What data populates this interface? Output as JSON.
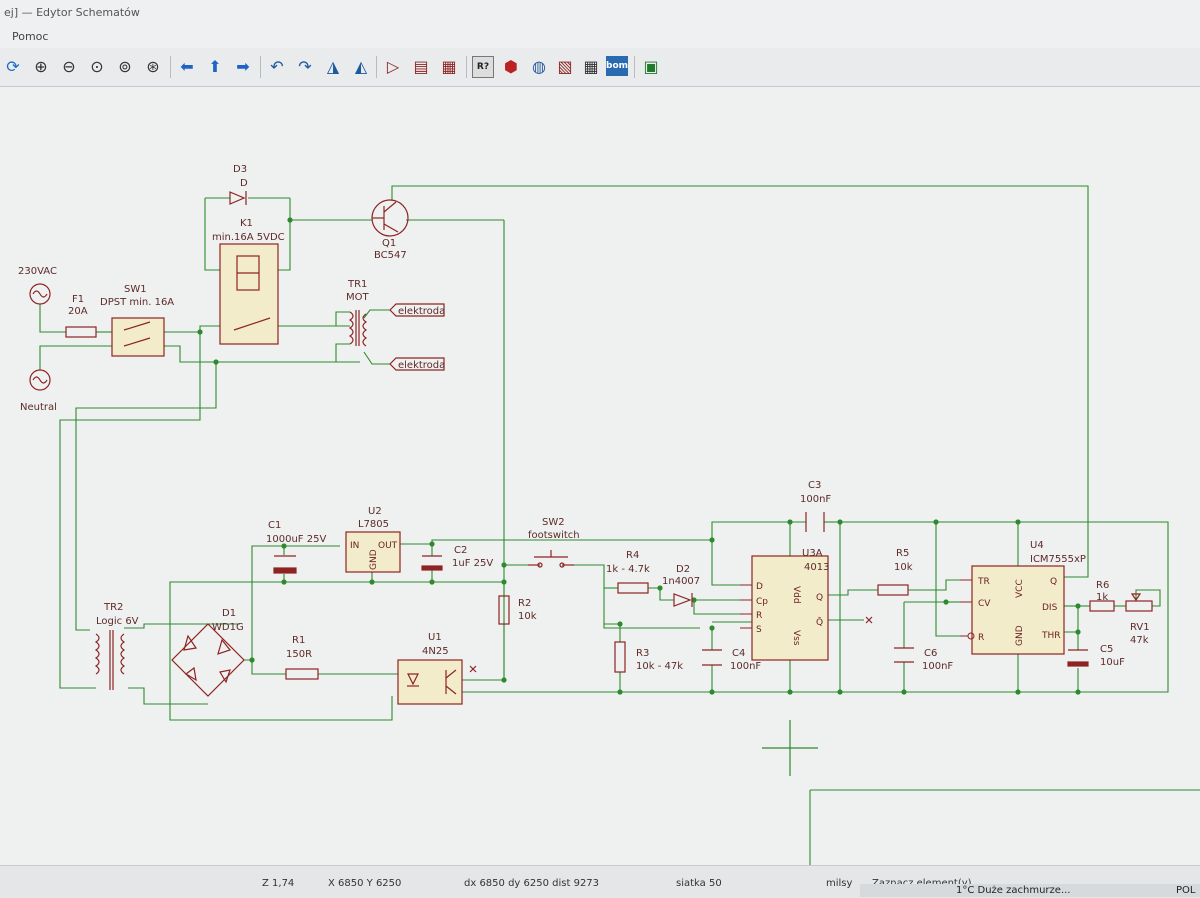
{
  "window": {
    "title": "ej] — Edytor Schematów"
  },
  "menu": {
    "help": "Pomoc"
  },
  "toolbar": {
    "icons": [
      "refresh-icon",
      "zoom-in-icon",
      "zoom-out-icon",
      "zoom-fit-icon",
      "zoom-redraw-icon",
      "zoom-selection-icon",
      "arrow-left-icon",
      "arrow-up-icon",
      "arrow-right-icon",
      "undo-icon",
      "redo-icon",
      "mirror-horizontal-icon",
      "mirror-vertical-icon",
      "erc-icon",
      "library-icon",
      "annotate-icon",
      "netlist-icon",
      "simulate-icon",
      "footprint-icon",
      "table-icon",
      "bom-icon",
      "pcb-icon"
    ]
  },
  "schematic": {
    "labels": {
      "d3_ref": "D3",
      "d3_val": "D",
      "k1_ref": "K1",
      "k1_val": "min.16A 5VDC",
      "q1_ref": "Q1",
      "q1_val": "BC547",
      "ac1": "230VAC",
      "neutral": "Neutral",
      "f1_ref": "F1",
      "f1_val": "20A",
      "sw1_ref": "SW1",
      "sw1_val": "DPST min. 16A",
      "tr1_ref": "TR1",
      "tr1_val": "MOT",
      "elektroda_1": "elektroda",
      "elektroda_2": "elektroda",
      "tr2_ref": "TR2",
      "tr2_val": "Logic 6V",
      "d1_ref": "D1",
      "d1_val": "WD1G",
      "c1_ref": "C1",
      "c1_val": "1000uF 25V",
      "u2_ref": "U2",
      "u2_val": "L7805",
      "u2_in": "IN",
      "u2_out": "OUT",
      "u2_gnd": "GND",
      "c2_ref": "C2",
      "c2_val": "1uF 25V",
      "sw2_ref": "SW2",
      "sw2_val": "footswitch",
      "r1_ref": "R1",
      "r1_val": "150R",
      "u1_ref": "U1",
      "u1_val": "4N25",
      "r2_ref": "R2",
      "r2_val": "10k",
      "r4_ref": "R4",
      "r4_val": "1k - 4.7k",
      "d2_ref": "D2",
      "d2_val": "1n4007",
      "r3_ref": "R3",
      "r3_val": "10k - 47k",
      "c4_ref": "C4",
      "c4_val": "100nF",
      "c3_ref": "C3",
      "c3_val": "100nF",
      "u3_ref": "U3A",
      "u3_val": "4013",
      "u3_d": "D",
      "u3_cp": "Cp",
      "u3_r": "R",
      "u3_s": "S",
      "u3_q": "Q",
      "u3_nq": "Q̄",
      "u3_vdd": "Vdd",
      "u3_vss": "Vss",
      "r5_ref": "R5",
      "r5_val": "10k",
      "u4_ref": "U4",
      "u4_val": "ICM7555xP",
      "u4_tr": "TR",
      "u4_cv": "CV",
      "u4_r": "R",
      "u4_q": "Q",
      "u4_dis": "DIS",
      "u4_thr": "THR",
      "u4_vcc": "VCC",
      "u4_gnd": "GND",
      "c6_ref": "C6",
      "c6_val": "100nF",
      "r6_ref": "R6",
      "r6_val": "1k",
      "rv1_ref": "RV1",
      "rv1_val": "47k",
      "c5_ref": "C5",
      "c5_val": "10uF"
    }
  },
  "status": {
    "zoom": "Z 1,74",
    "coords": "X 6850  Y 6250",
    "delta": "dx 6850  dy 6250  dist 9273",
    "grid": "siatka 50",
    "units": "milsy",
    "mode": "Zaznacz element(y)"
  },
  "taskbar": {
    "weather": "1°C  Duże zachmurze...",
    "lang": "POL"
  },
  "colors": {
    "wire": "#2e8a2e",
    "component": "#8e2323",
    "fill": "#f3eccb",
    "junction": "#2e8a2e"
  }
}
